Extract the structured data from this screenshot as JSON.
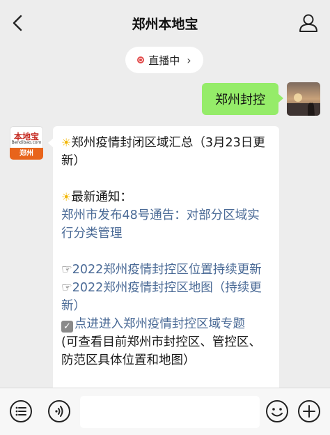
{
  "header": {
    "title": "郑州本地宝"
  },
  "live": {
    "label": "直播中",
    "chevron": "›"
  },
  "my_message": {
    "text": "郑州封控"
  },
  "bot": {
    "avatar": {
      "brand": "本地宝",
      "sub": "Bendibao.com",
      "city": "郑州"
    },
    "message": {
      "line1_icon": "☀",
      "line1": "郑州疫情封闭区域汇总（3月23日更新）",
      "line2_icon": "☀",
      "line2": "最新通知：",
      "link1": "郑州市发布48号通告：对部分区域实行分类管理",
      "link2_icon": "☞",
      "link2": "2022郑州疫情封控区位置持续更新",
      "link3_icon": "☞",
      "link3": "2022郑州疫情封控区地图（持续更新）",
      "link4_icon": "✓",
      "link4": "点进进入郑州疫情封控区域专题",
      "note": "(可查看目前郑州市封控区、管控区、防范区具体位置和地图）"
    }
  },
  "toolbar": {
    "menu_icon": "list-icon",
    "voice_icon": "voice-icon",
    "input_value": "",
    "emoji_icon": "emoji-icon",
    "plus_icon": "plus-icon"
  }
}
